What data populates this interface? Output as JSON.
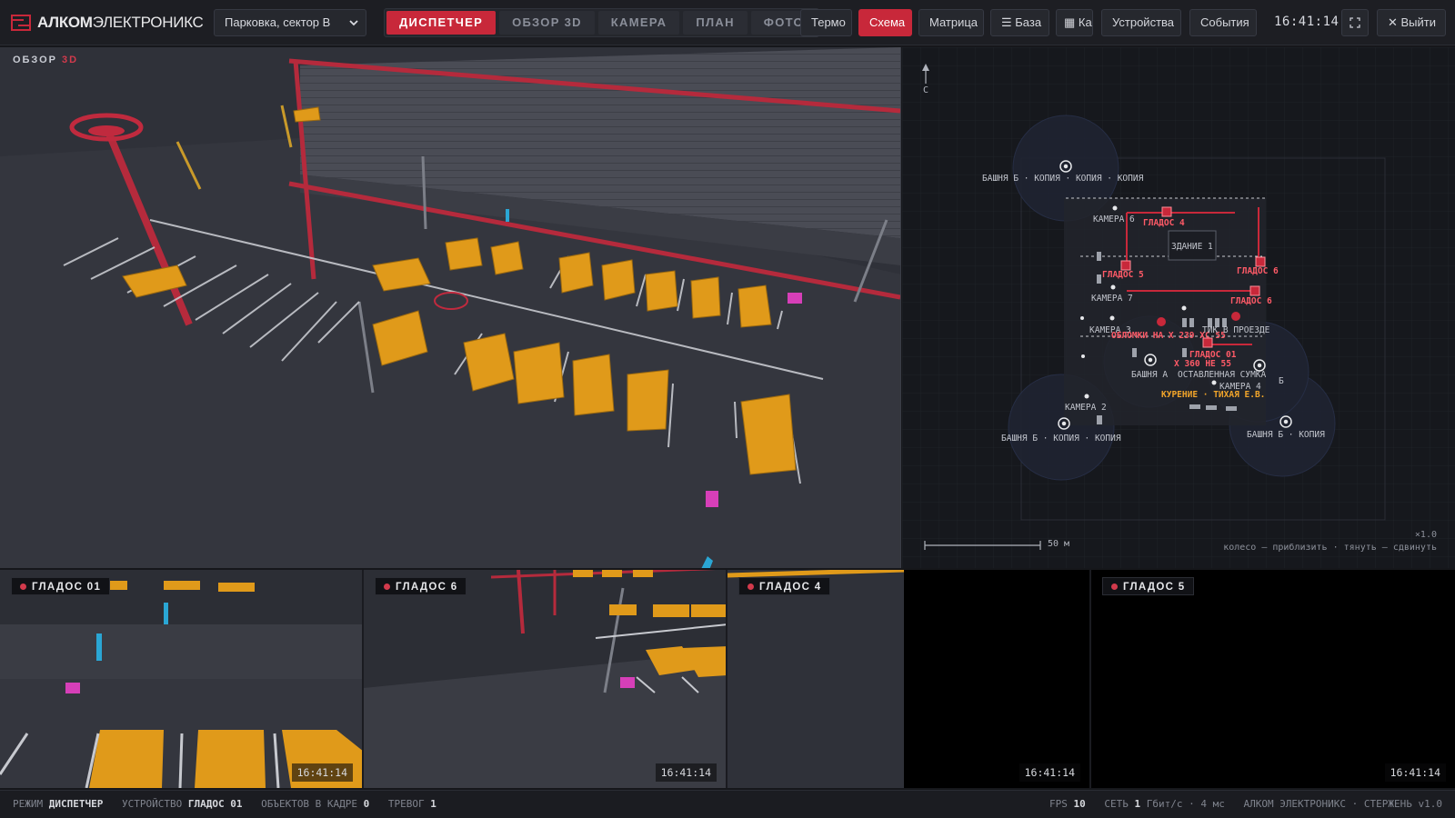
{
  "app": {
    "brand_bold": "АЛКОМ",
    "brand_light": "ЭЛЕКТРОНИКС",
    "site_select": "Парковка, сектор В",
    "clock": "16:41:14",
    "colors": {
      "accent": "#c8283a",
      "vehicle": "#e09a1a",
      "pole": "#c02a3e",
      "bollard": "#2aa6d4",
      "object": "#d63fb8",
      "zone_amber": "#f2a52a"
    }
  },
  "modes": [
    {
      "label": "ДИСПЕТЧЕР",
      "active": true
    },
    {
      "label": "ОБЗОР 3D",
      "active": false
    },
    {
      "label": "КАМЕРА",
      "active": false
    },
    {
      "label": "ПЛАН",
      "active": false
    },
    {
      "label": "ФОТО",
      "active": false
    }
  ],
  "toolbar": {
    "thermo": "Термо",
    "scheme": "Схема",
    "matrix": "Матрица",
    "base": "☰ База",
    "ka": "▦ Ка",
    "devices": "Устройства",
    "events": "События",
    "fullscreen_icon": "fullscreen-icon",
    "exit": "✕ Выйти"
  },
  "view3d": {
    "label": "ОБЗОР",
    "label_accent": "3D"
  },
  "plan": {
    "north": "С",
    "building": "ЗДАНИЕ 1",
    "scale": "50 м",
    "zoom": "×1.0",
    "hint": "колесо — приблизить · тянуть — сдвинуть",
    "labels": {
      "tower_top": "БАШНЯ Б · КОПИЯ · КОПИЯ · КОПИЯ",
      "cam6": "КАМЕРА 6",
      "glados4": "ГЛАДОС 4",
      "glados5": "ГЛАДОС 5",
      "glados6a": "ГЛАДОС 6",
      "glados6b": "ГЛАДОС 6",
      "cam7": "КАМЕРА 7",
      "cam3": "КАМЕРА 3",
      "debris": "ОБЛОМКИ НА  Х 239 ХС 55",
      "passage": "ТИК В ПРОЕЗДЕ",
      "glados01": "ГЛАДОС 01",
      "plate": "Х 360 НЕ 55",
      "tower_a": "БАШНЯ А",
      "bag": "ОСТАВЛЕННАЯ СУМКА",
      "cam4": "КАМЕРА 4",
      "tower_b_small": "Б",
      "smoking": "КУРЕНИЕ · ТИХАЯ Е.В.",
      "cam2": "КАМЕРА 2",
      "tower_bl": "БАШНЯ Б · КОПИЯ · КОПИЯ",
      "tower_br": "БАШНЯ Б · КОПИЯ"
    }
  },
  "cameras": [
    {
      "name": "ГЛАДОС 01",
      "time": "16:41:14"
    },
    {
      "name": "ГЛАДОС 6",
      "time": "16:41:14"
    },
    {
      "name": "ГЛАДОС 4",
      "time": "16:41:14"
    },
    {
      "name": "ГЛАДОС 5",
      "time": "16:41:14"
    }
  ],
  "status": {
    "mode_label": "РЕЖИМ",
    "mode_value": "ДИСПЕТЧЕР",
    "device_label": "УСТРОЙСТВО",
    "device_value": "ГЛАДОС 01",
    "objects_label": "ОБЪЕКТОВ В КАДРЕ",
    "objects_value": "0",
    "alarms_label": "ТРЕВОГ",
    "alarms_value": "1",
    "fps_label": "FPS",
    "fps_value": "10",
    "net_label": "СЕТЬ",
    "net_value": "1",
    "net_rest": "Гбит/с · 4 мс",
    "vendor": "АЛКОМ ЭЛЕКТРОНИКС · СТЕРЖЕНЬ v1.0"
  }
}
